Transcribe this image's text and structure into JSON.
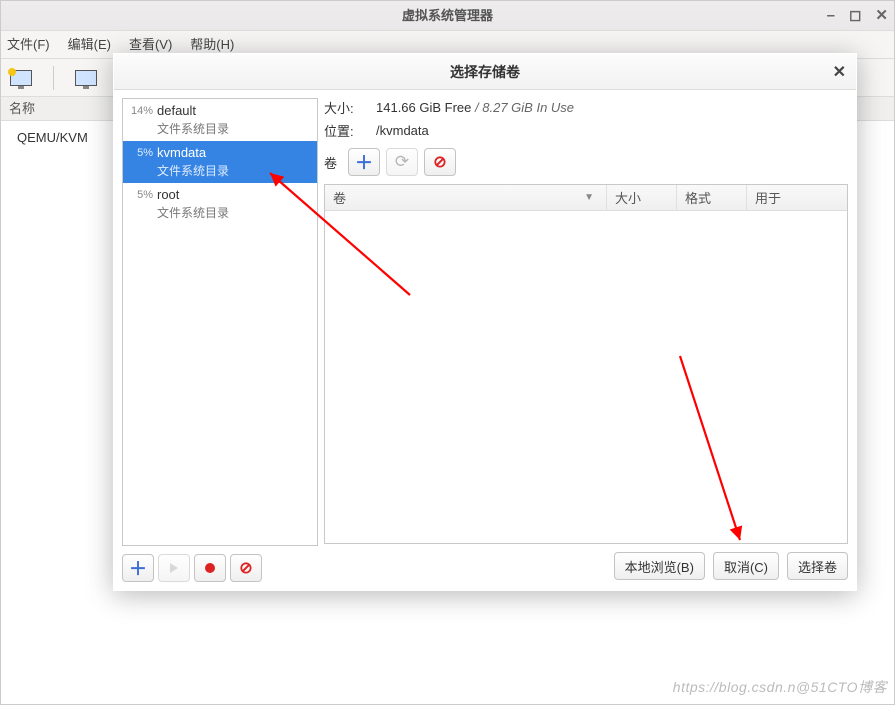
{
  "main_window": {
    "title": "虚拟系统管理器",
    "menus": {
      "file": "文件(F)",
      "edit": "编辑(E)",
      "view": "查看(V)",
      "help": "帮助(H)"
    },
    "sidebar_header": "名称",
    "tree_item": "QEMU/KVM"
  },
  "modal": {
    "title": "选择存储卷",
    "pools": [
      {
        "pct": "14%",
        "name": "default",
        "sub": "文件系统目录",
        "selected": false
      },
      {
        "pct": "5%",
        "name": "kvmdata",
        "sub": "文件系统目录",
        "selected": true
      },
      {
        "pct": "5%",
        "name": "root",
        "sub": "文件系统目录",
        "selected": false
      }
    ],
    "info": {
      "size_label": "大小:",
      "size_free": "141.66 GiB Free",
      "size_sep": "/",
      "size_used": "8.27 GiB In Use",
      "path_label": "位置:",
      "path_value": "/kvmdata",
      "vol_label": "卷"
    },
    "vol_columns": {
      "vol": "卷",
      "size": "大小",
      "format": "格式",
      "used_for": "用于"
    },
    "buttons": {
      "browse": "本地浏览(B)",
      "cancel": "取消(C)",
      "choose": "选择卷"
    }
  },
  "watermark": "https://blog.csdn.n@51CTO博客"
}
